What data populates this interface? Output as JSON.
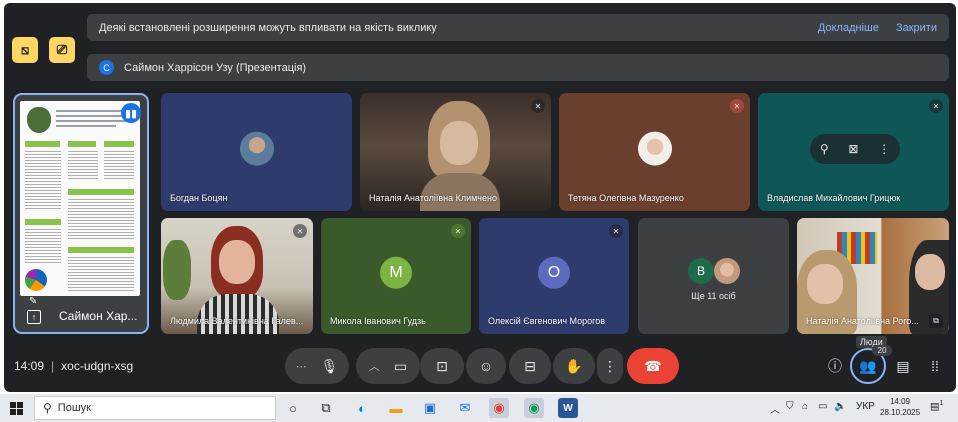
{
  "colors": {
    "meet_background": "#202124",
    "tile_grey": "#3c4043",
    "accent_blue": "#8ab4f8",
    "end_call_red": "#ea4335",
    "warning_yellow": "#fdd663"
  },
  "banners": {
    "extensions_notice": "Деякі встановлені розширення можуть впливати на якість виклику",
    "learn_more": "Докладніше",
    "close": "Закрити",
    "presenter_avatar_letter": "С",
    "presenter_label": "Саймон Харрісон Узу (Презентація)"
  },
  "pinned": {
    "name": "Саймон Хар..."
  },
  "tiles": {
    "t1": "Богдан Боцян",
    "t2": "Наталія Анатоліївна Климчено",
    "t3": "Тетяна Олегівна Мазуренко",
    "t4": "Владислав Михайлович Грицюк",
    "t5": "Людмила Валентинівна Галев...",
    "t6": "Микола Іванович Гудзь",
    "t6_letter": "М",
    "t7": "Олексій Євгенович Морогов",
    "t7_letter": "О",
    "t8_more": "Ще 11 осіб",
    "t8_letter": "В",
    "t9": "Наталія Анатоліївна Рого..."
  },
  "bottom_bar": {
    "time": "14:09",
    "meeting_code": "xoc-udgn-xsg",
    "people_tooltip": "Люди",
    "people_count": "20"
  },
  "taskbar": {
    "search_placeholder": "Пошук",
    "language": "УКР",
    "clock_time": "14:09",
    "clock_date": "28.10.2025",
    "notification_count": "1"
  }
}
